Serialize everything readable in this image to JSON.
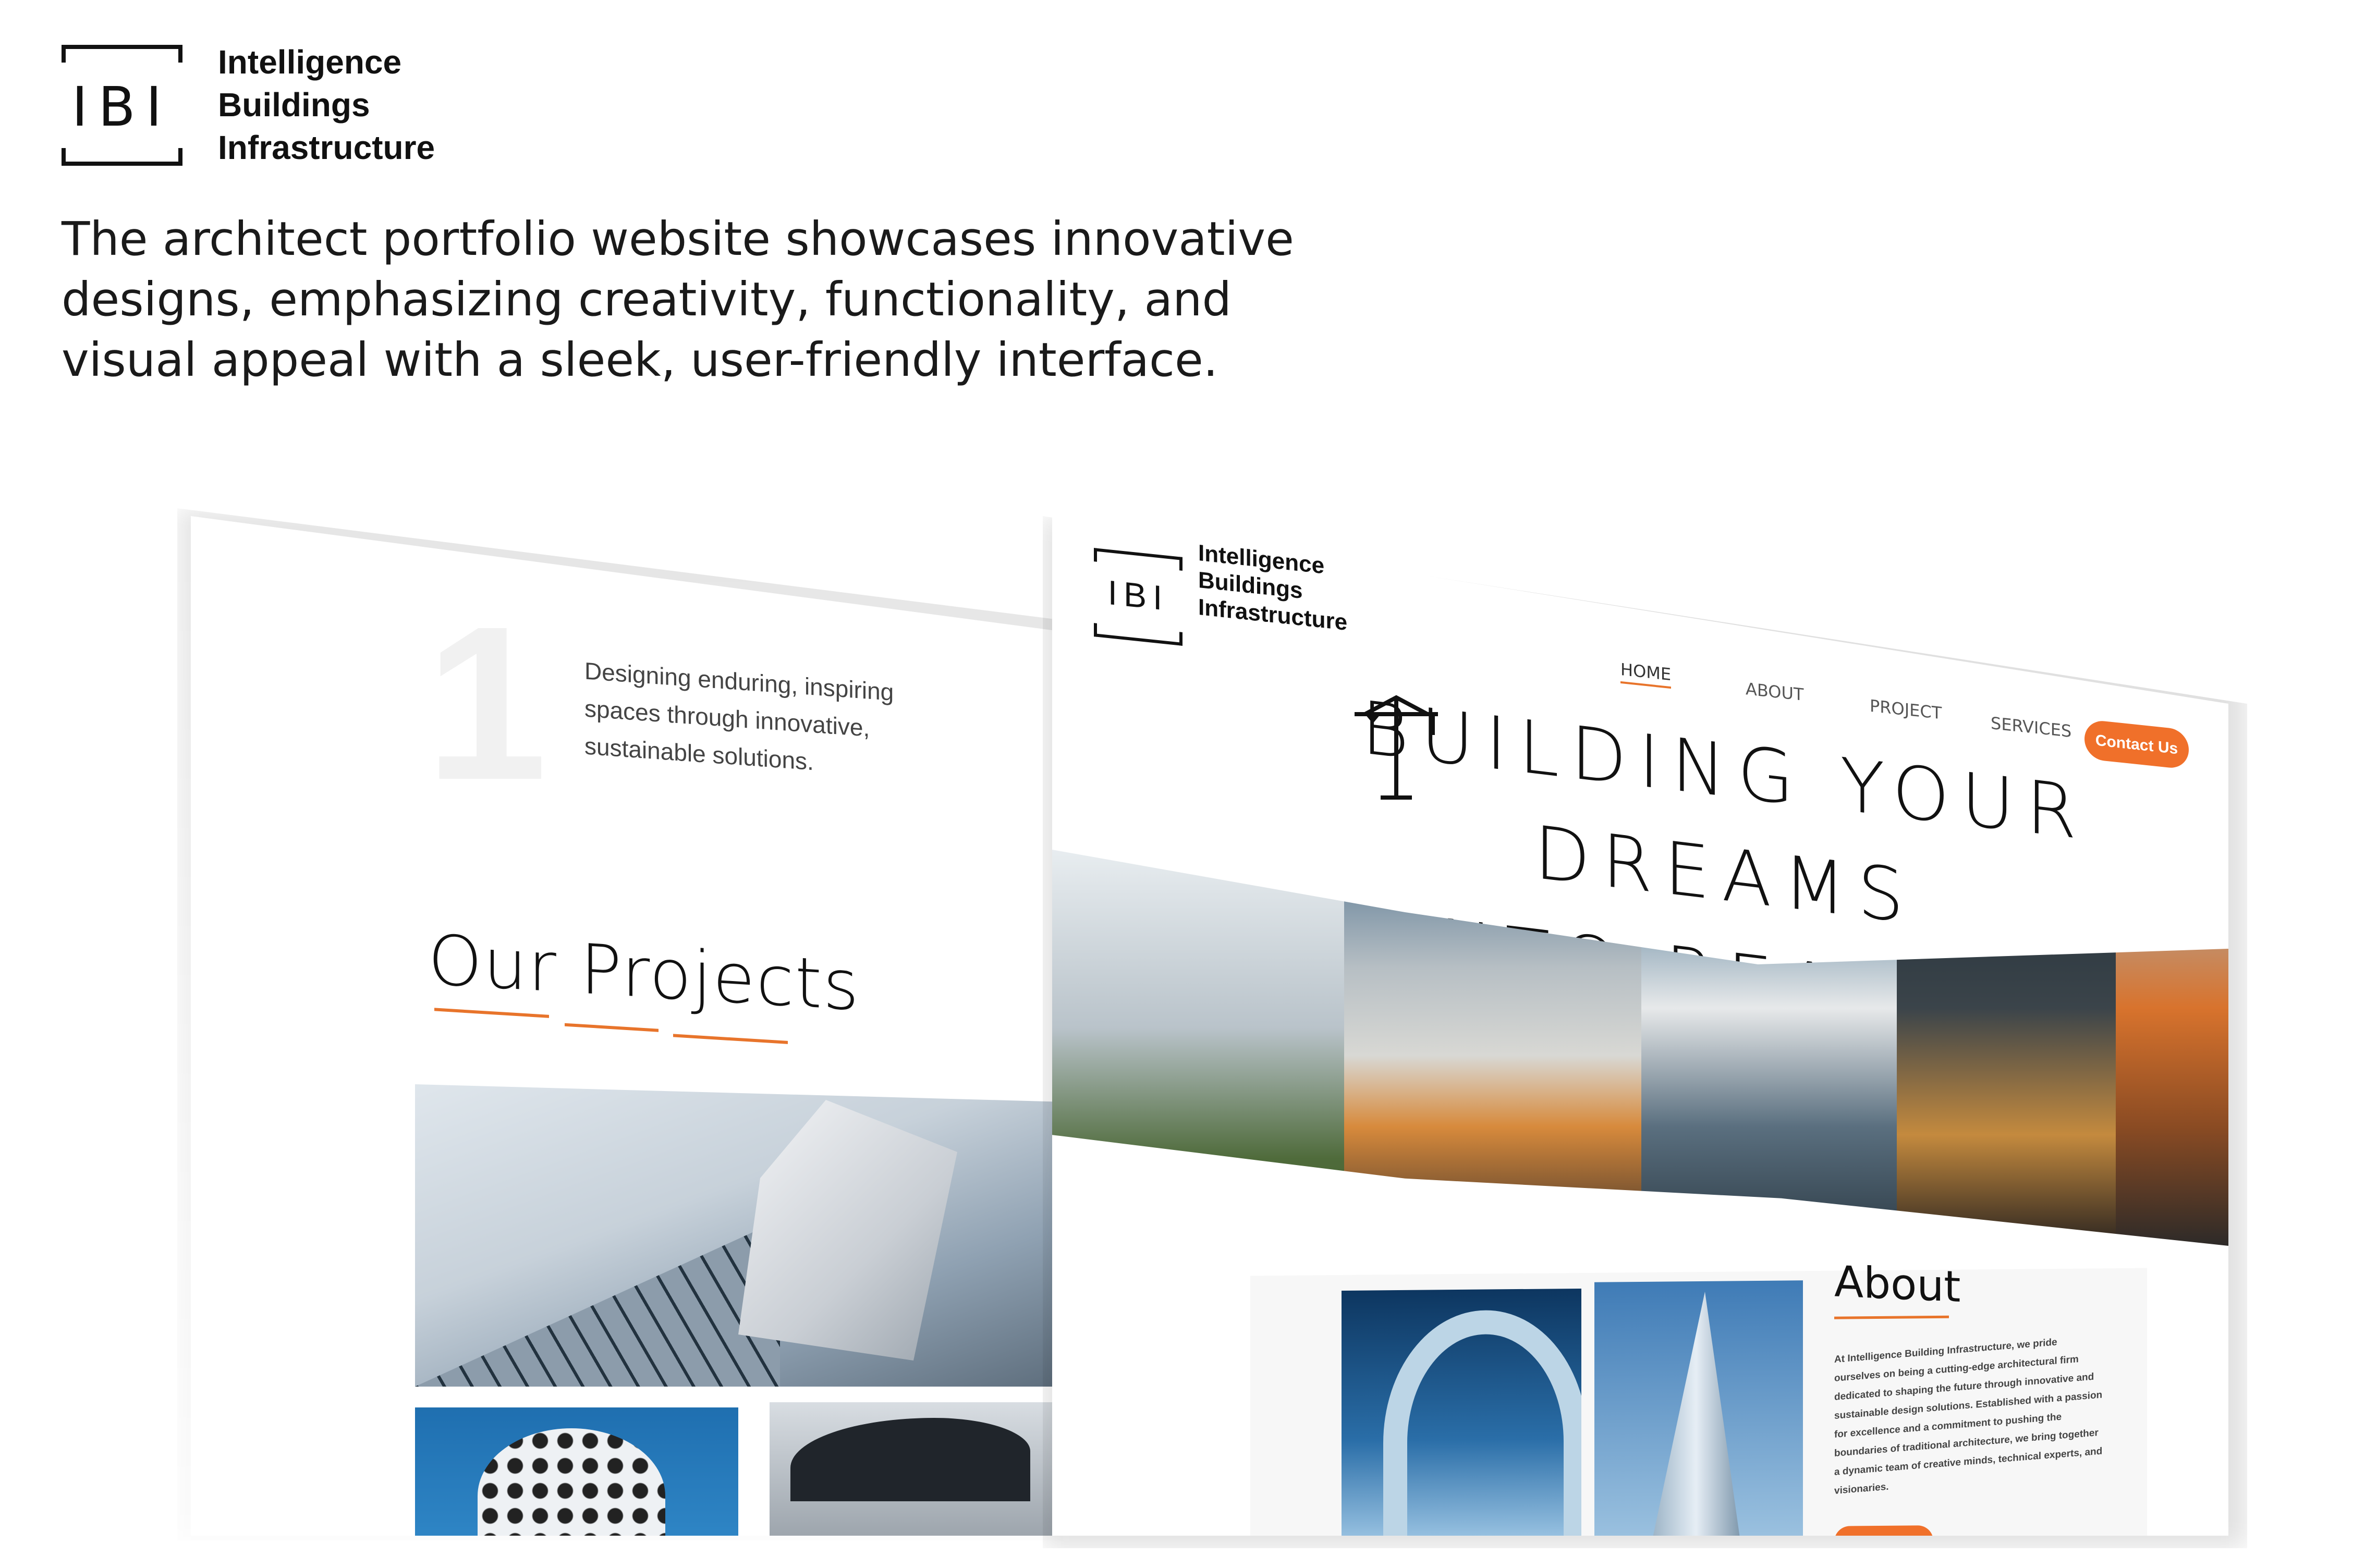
{
  "brand": {
    "logo_mark": "IBI",
    "line1": "Intelligence",
    "line2": "Buildings",
    "line3": "Infrastructure"
  },
  "tagline": "The architect portfolio website showcases innovative designs, emphasizing creativity, functionality, and visual appeal with a sleek, user-friendly interface.",
  "left_page": {
    "number": "1",
    "feature_text": "Designing enduring, inspiring spaces through innovative, sustainable solutions.",
    "section_title": "Our Projects"
  },
  "right_page": {
    "logo_mark": "IBI",
    "brand_line1": "Intelligence",
    "brand_line2": "Buildings",
    "brand_line3": "Infrastructure",
    "nav": [
      "HOME",
      "ABOUT",
      "PROJECT",
      "SERVICES"
    ],
    "contact_label": "Contact Us",
    "hero_line1": "BUILDING YOUR DREAMS",
    "hero_line2": "INTO REALITY",
    "about_title": "About",
    "about_body": "At Intelligence Building Infrastructure, we pride ourselves on being a cutting-edge architectural firm dedicated to shaping the future through innovative and sustainable design solutions. Established with a passion for excellence and a commitment to pushing the boundaries of traditional architecture, we bring together a dynamic team of creative minds, technical experts, and visionaries."
  },
  "colors": {
    "accent": "#f0702a",
    "text": "#111111",
    "muted": "#555555"
  },
  "icons": [
    "crane-icon"
  ]
}
